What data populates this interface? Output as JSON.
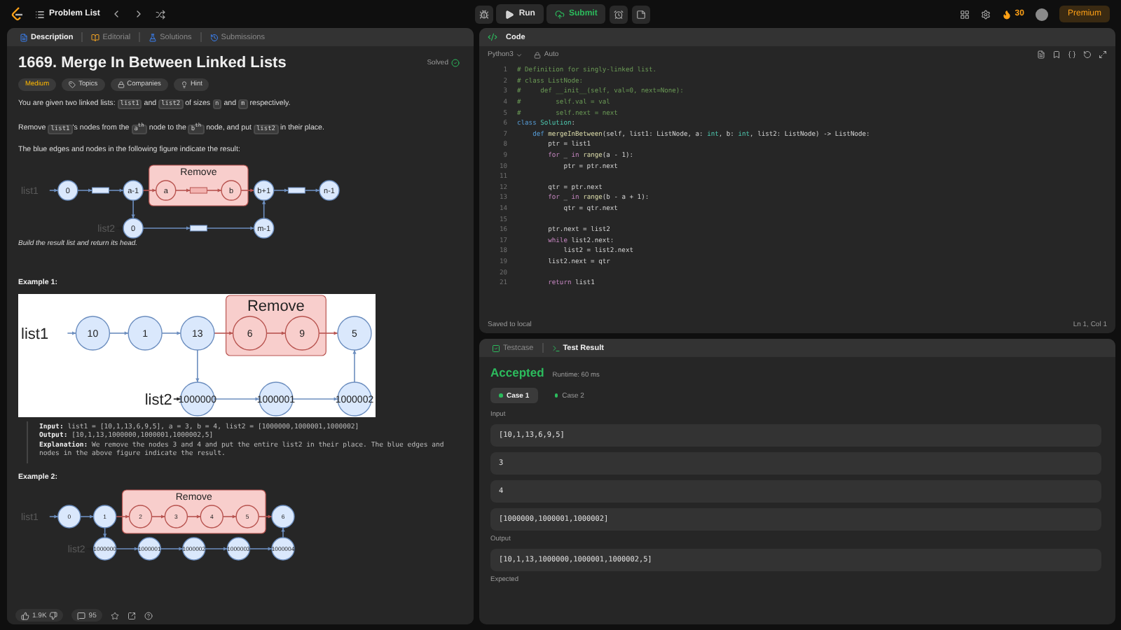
{
  "top_bar": {
    "problem_list": "Problem List",
    "run": "Run",
    "submit": "Submit",
    "streak": "30",
    "premium": "Premium"
  },
  "description_panel": {
    "tabs": [
      {
        "label": "Description",
        "kind": "description",
        "selected": true
      },
      {
        "label": "Editorial",
        "kind": "editorial",
        "selected": false
      },
      {
        "label": "Solutions",
        "kind": "solutions",
        "selected": false
      },
      {
        "label": "Submissions",
        "kind": "submissions",
        "selected": false
      }
    ],
    "title": "1669. Merge In Between Linked Lists",
    "status": "Solved",
    "tags": [
      {
        "label": "Medium",
        "kind": "difficulty"
      },
      {
        "label": "Topics",
        "kind": "topics"
      },
      {
        "label": "Companies",
        "kind": "companies"
      },
      {
        "label": "Hint",
        "kind": "hint"
      }
    ],
    "paragraphs": [
      {
        "parts": [
          {
            "kind": "text",
            "text": "You are given two linked lists: "
          },
          {
            "kind": "code",
            "text": "list1"
          },
          {
            "kind": "text",
            "text": " and "
          },
          {
            "kind": "code",
            "text": "list2"
          },
          {
            "kind": "text",
            "text": " of sizes "
          },
          {
            "kind": "code",
            "text": "n"
          },
          {
            "kind": "text",
            "text": " and "
          },
          {
            "kind": "code",
            "text": "m"
          },
          {
            "kind": "text",
            "text": " respectively."
          }
        ]
      },
      {
        "parts": [
          {
            "kind": "text",
            "text": "Remove "
          },
          {
            "kind": "code",
            "text": "list1"
          },
          {
            "kind": "text",
            "text": "'s nodes from the "
          },
          {
            "kind": "code",
            "text": "a$^{th}$"
          },
          {
            "kind": "text",
            "text": " node to the "
          },
          {
            "kind": "code",
            "text": "b$^{th}$"
          },
          {
            "kind": "text",
            "text": " node, and put "
          },
          {
            "kind": "code",
            "text": "list2"
          },
          {
            "kind": "text",
            "text": " in their place."
          }
        ]
      },
      {
        "parts": [
          {
            "kind": "text",
            "text": "The blue edges and nodes in the following figure indicate the result:"
          }
        ]
      }
    ],
    "figure": {
      "kind": "inline",
      "remove_label": "Remove",
      "list_labels": [
        "list1",
        "list2"
      ],
      "row1": [
        {
          "kind": "node",
          "label": "0",
          "removed": false
        },
        {
          "kind": "gap",
          "removed": false
        },
        {
          "kind": "node",
          "label": "a-1",
          "removed": false
        },
        {
          "kind": "node",
          "label": "a",
          "removed": true
        },
        {
          "kind": "gap",
          "removed": true
        },
        {
          "kind": "node",
          "label": "b",
          "removed": true
        },
        {
          "kind": "node",
          "label": "b+1",
          "removed": false
        },
        {
          "kind": "gap",
          "removed": false
        },
        {
          "kind": "node",
          "label": "n-1",
          "removed": false
        }
      ],
      "row2": [
        {
          "kind": "node",
          "label": "0"
        },
        {
          "kind": "gap"
        },
        {
          "kind": "node",
          "label": "m-1"
        }
      ]
    },
    "note": "Build the result list and return its head.",
    "examples": [
      {
        "heading": "Example 1:",
        "figure": {
          "kind": "image",
          "remove_label": "Remove",
          "list_labels": [
            "list1",
            "list2"
          ],
          "row1": [
            {
              "kind": "node",
              "label": "10",
              "removed": false
            },
            {
              "kind": "node",
              "label": "1",
              "removed": false
            },
            {
              "kind": "node",
              "label": "13",
              "removed": false
            },
            {
              "kind": "node",
              "label": "6",
              "removed": true
            },
            {
              "kind": "node",
              "label": "9",
              "removed": true
            },
            {
              "kind": "node",
              "label": "5",
              "removed": false
            }
          ],
          "row2": [
            {
              "kind": "node",
              "label": "1000000"
            },
            {
              "kind": "node",
              "label": "1000001"
            },
            {
              "kind": "node",
              "label": "1000002"
            }
          ]
        },
        "lines": [
          {
            "label": "Input:",
            "text": "list1 = [10,1,13,6,9,5], a = 3, b = 4, list2 = [1000000,1000001,1000002]"
          },
          {
            "label": "Output:",
            "text": "[10,1,13,1000000,1000001,1000002,5]"
          },
          {
            "label": "Explanation:",
            "text": "We remove the nodes 3 and 4 and put the entire list2 in their place. The blue edges and nodes in the above figure indicate the result."
          }
        ]
      },
      {
        "heading": "Example 2:",
        "figure": {
          "kind": "inline",
          "remove_label": "Remove",
          "list_labels": [
            "list1",
            "list2"
          ],
          "row1": [
            {
              "kind": "node",
              "label": "0",
              "removed": false
            },
            {
              "kind": "node",
              "label": "1",
              "removed": false
            },
            {
              "kind": "node",
              "label": "2",
              "removed": true
            },
            {
              "kind": "node",
              "label": "3",
              "removed": true
            },
            {
              "kind": "node",
              "label": "4",
              "removed": true
            },
            {
              "kind": "node",
              "label": "5",
              "removed": true
            },
            {
              "kind": "node",
              "label": "6",
              "removed": false
            }
          ],
          "row2": [
            {
              "kind": "node",
              "label": "1000000"
            },
            {
              "kind": "node",
              "label": "1000001"
            },
            {
              "kind": "node",
              "label": "1000002"
            },
            {
              "kind": "node",
              "label": "1000003"
            },
            {
              "kind": "node",
              "label": "1000004"
            }
          ]
        }
      }
    ],
    "footer": {
      "likes": "1.9K",
      "comments": "95"
    }
  },
  "code_panel": {
    "title": "Code",
    "language": "Python3",
    "mode": "Auto",
    "lines": [
      {
        "number": "1",
        "tokens": [
          {
            "kind": "comment",
            "text": "# Definition for singly-linked list."
          }
        ]
      },
      {
        "number": "2",
        "tokens": [
          {
            "kind": "comment",
            "text": "# class ListNode:"
          }
        ]
      },
      {
        "number": "3",
        "tokens": [
          {
            "kind": "comment",
            "text": "#     def __init__(self, val=0, next=None):"
          }
        ]
      },
      {
        "number": "4",
        "tokens": [
          {
            "kind": "comment",
            "text": "#         self.val = val"
          }
        ]
      },
      {
        "number": "5",
        "tokens": [
          {
            "kind": "comment",
            "text": "#         self.next = next"
          }
        ]
      },
      {
        "number": "6",
        "tokens": [
          {
            "kind": "keyword",
            "text": "class "
          },
          {
            "kind": "type",
            "text": "Solution"
          },
          {
            "kind": "plain",
            "text": ":"
          }
        ]
      },
      {
        "number": "7",
        "tokens": [
          {
            "kind": "keyword",
            "text": "    def "
          },
          {
            "kind": "function",
            "text": "mergeInBetween"
          },
          {
            "kind": "plain",
            "text": "(self, list1: ListNode, a: "
          },
          {
            "kind": "type",
            "text": "int"
          },
          {
            "kind": "plain",
            "text": ", b: "
          },
          {
            "kind": "type",
            "text": "int"
          },
          {
            "kind": "plain",
            "text": ", list2: ListNode) -> ListNode:"
          }
        ]
      },
      {
        "number": "8",
        "tokens": [
          {
            "kind": "plain",
            "text": "        ptr = list1"
          }
        ]
      },
      {
        "number": "9",
        "tokens": [
          {
            "kind": "control",
            "text": "        for"
          },
          {
            "kind": "plain",
            "text": " _ "
          },
          {
            "kind": "control",
            "text": "in "
          },
          {
            "kind": "function",
            "text": "range"
          },
          {
            "kind": "plain",
            "text": "(a - 1):"
          }
        ]
      },
      {
        "number": "10",
        "tokens": [
          {
            "kind": "plain",
            "text": "            ptr = ptr.next"
          }
        ]
      },
      {
        "number": "11"
      },
      {
        "number": "12",
        "tokens": [
          {
            "kind": "plain",
            "text": "        qtr = ptr.next"
          }
        ]
      },
      {
        "number": "13",
        "tokens": [
          {
            "kind": "control",
            "text": "        for"
          },
          {
            "kind": "plain",
            "text": " _ "
          },
          {
            "kind": "control",
            "text": "in "
          },
          {
            "kind": "function",
            "text": "range"
          },
          {
            "kind": "plain",
            "text": "(b - a + 1):"
          }
        ]
      },
      {
        "number": "14",
        "tokens": [
          {
            "kind": "plain",
            "text": "            qtr = qtr.next"
          }
        ]
      },
      {
        "number": "15"
      },
      {
        "number": "16",
        "tokens": [
          {
            "kind": "plain",
            "text": "        ptr.next = list2"
          }
        ]
      },
      {
        "number": "17",
        "tokens": [
          {
            "kind": "control",
            "text": "        while"
          },
          {
            "kind": "plain",
            "text": " list2.next:"
          }
        ]
      },
      {
        "number": "18",
        "tokens": [
          {
            "kind": "plain",
            "text": "            list2 = list2.next"
          }
        ]
      },
      {
        "number": "19",
        "tokens": [
          {
            "kind": "plain",
            "text": "        list2.next = qtr"
          }
        ]
      },
      {
        "number": "20"
      },
      {
        "number": "21",
        "tokens": [
          {
            "kind": "control",
            "text": "        return"
          },
          {
            "kind": "plain",
            "text": " list1"
          }
        ]
      }
    ],
    "status": "Saved to local",
    "cursor": "Ln 1, Col 1"
  },
  "result_panel": {
    "tabs": [
      {
        "label": "Testcase",
        "kind": "testcase",
        "selected": false
      },
      {
        "label": "Test Result",
        "kind": "result",
        "selected": true
      }
    ],
    "verdict": "Accepted",
    "runtime": "Runtime: 60 ms",
    "cases": [
      {
        "label": "Case 1",
        "selected": true,
        "passed": true
      },
      {
        "label": "Case 2",
        "selected": false,
        "passed": true
      }
    ],
    "sections": [
      {
        "label": "Input",
        "values": [
          "[10,1,13,6,9,5]",
          "3",
          "4",
          "[1000000,1000001,1000002]"
        ]
      },
      {
        "label": "Output",
        "values": [
          "[10,1,13,1000000,1000001,1000002,5]"
        ]
      },
      {
        "label": "Expected"
      }
    ]
  }
}
